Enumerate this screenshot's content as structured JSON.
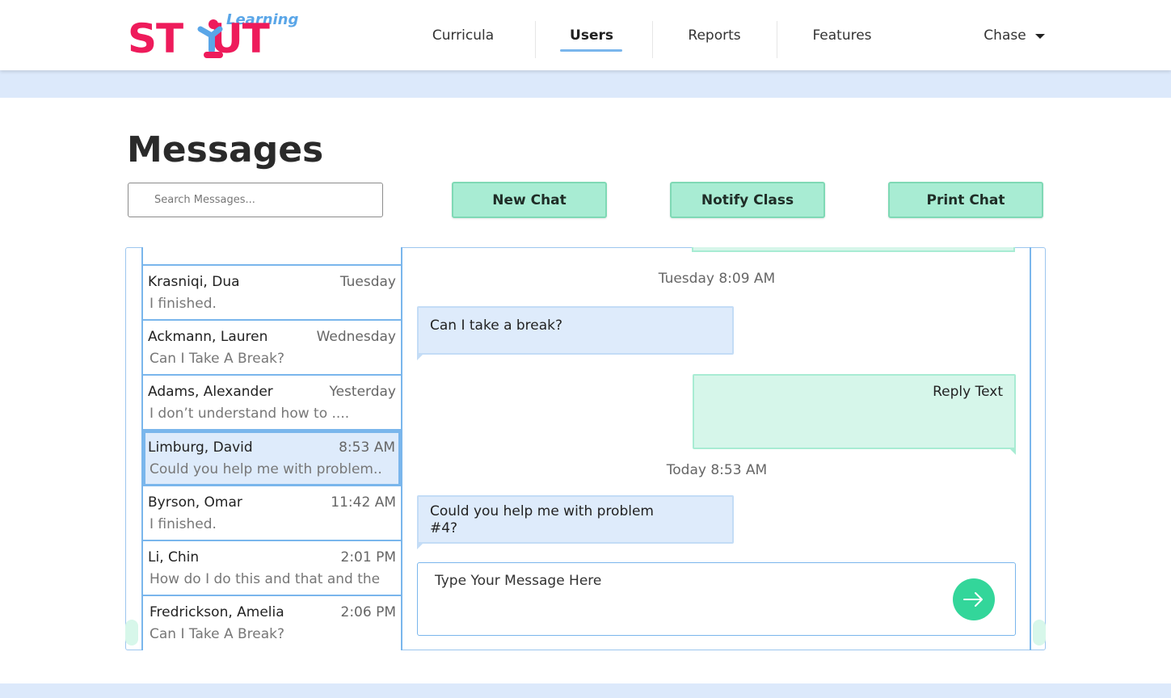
{
  "brand": {
    "logo_text": "ST UT",
    "logo_sub": "Learning"
  },
  "nav": {
    "items": [
      {
        "label": "Curricula",
        "active": false
      },
      {
        "label": "Users",
        "active": true
      },
      {
        "label": "Reports",
        "active": false
      },
      {
        "label": "Features",
        "active": false
      }
    ],
    "user_menu_label": "Chase"
  },
  "page": {
    "title": "Messages"
  },
  "search": {
    "placeholder": "Search Messages..."
  },
  "actions": {
    "new_chat": "New Chat",
    "notify_class": "Notify Class",
    "print_chat": "Print Chat"
  },
  "conversations": [
    {
      "name": "Krasniqi, Dua",
      "time": "Tuesday",
      "preview": "I finished."
    },
    {
      "name": "Ackmann, Lauren",
      "time": "Wednesday",
      "preview": "Can I Take A Break?"
    },
    {
      "name": "Adams, Alexander",
      "time": "Yesterday",
      "preview": "I don’t understand how to ...."
    },
    {
      "name": "Limburg, David",
      "time": "8:53 AM",
      "preview": "Could you help me with problem..",
      "selected": true
    },
    {
      "name": "Byrson, Omar",
      "time": "11:42 AM",
      "preview": "I finished."
    },
    {
      "name": "Li, Chin",
      "time": "2:01 PM",
      "preview": "How do I do this and that and the"
    },
    {
      "name": "Fredrickson, Amelia",
      "time": "2:06 PM",
      "preview": "Can I Take A Break?"
    }
  ],
  "thread": {
    "timestamp_1": "Tuesday 8:09 AM",
    "incoming_1": "Can I take a break?",
    "outgoing_1": "Reply Text",
    "timestamp_2": "Today 8:53 AM",
    "incoming_2_line1": "Could you help me with problem",
    "incoming_2_line2": "#4?"
  },
  "composer": {
    "placeholder": "Type Your Message Here"
  },
  "colors": {
    "accent_blue": "#7ab6ec",
    "accent_green": "#33d69a",
    "brand_pink": "#ee1b5b",
    "button_green": "#a8ecd3"
  }
}
